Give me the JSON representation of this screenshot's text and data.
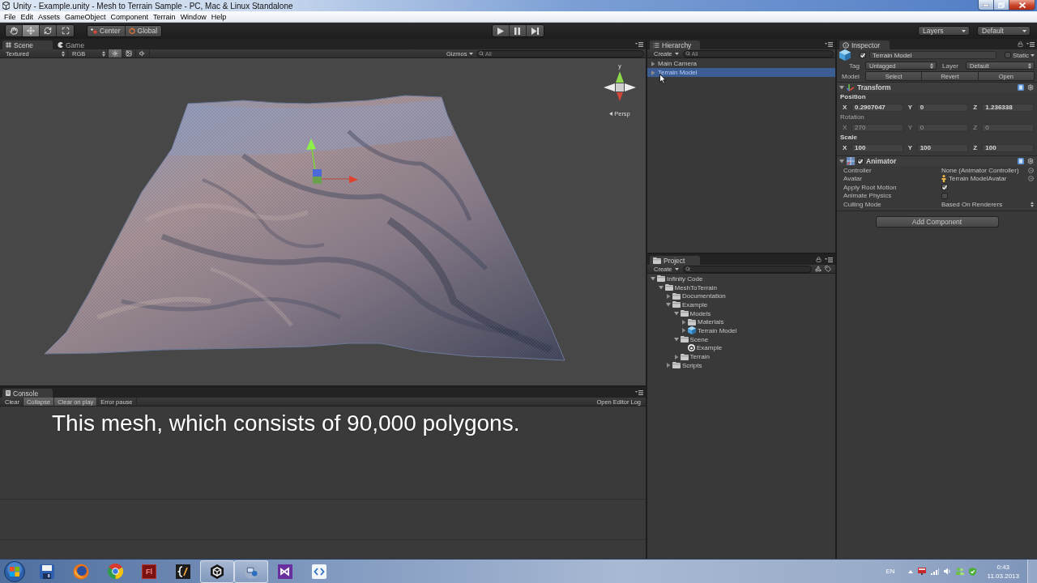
{
  "window": {
    "title": "Unity - Example.unity - Mesh to Terrain Sample - PC, Mac & Linux Standalone"
  },
  "menu": [
    "File",
    "Edit",
    "Assets",
    "GameObject",
    "Component",
    "Terrain",
    "Window",
    "Help"
  ],
  "toolbar": {
    "tools": [
      {
        "kind": "hand",
        "selected": false
      },
      {
        "kind": "move",
        "selected": true
      },
      {
        "kind": "rotate",
        "selected": false
      },
      {
        "kind": "scale",
        "selected": false
      }
    ],
    "pivot": [
      {
        "kind": "center",
        "label": "Center"
      },
      {
        "kind": "global",
        "label": "Global"
      }
    ],
    "playback": [
      {
        "kind": "play",
        "on": false
      },
      {
        "kind": "pause",
        "on": false
      },
      {
        "kind": "step",
        "on": false
      }
    ],
    "layers": "Layers",
    "layout": "Default"
  },
  "scene": {
    "tabs": [
      {
        "kind": "scene",
        "label": "Scene",
        "selected": true
      },
      {
        "kind": "game",
        "label": "Game",
        "selected": false
      }
    ],
    "render_mode": "Textured",
    "channel": "RGB",
    "toggles": [
      {
        "kind": "lighting",
        "on": true
      },
      {
        "kind": "skybox",
        "on": false
      },
      {
        "kind": "audio",
        "on": false
      }
    ],
    "gizmos": "Gizmos",
    "search_placeholder": "All",
    "axis_label": "y",
    "projection": "Persp"
  },
  "console": {
    "tab": "Console",
    "buttons": [
      {
        "label": "Clear",
        "on": false
      },
      {
        "label": "Collapse",
        "on": true
      },
      {
        "label": "Clear on play",
        "on": true
      },
      {
        "label": "Error pause",
        "on": false
      }
    ],
    "editor_log": "Open Editor Log"
  },
  "subtitle": "This mesh, which consists of 90,000 polygons.",
  "hierarchy": {
    "tab": "Hierarchy",
    "create": "Create",
    "search_placeholder": "All",
    "items": [
      {
        "label": "Main Camera",
        "expanded": false,
        "selected": false
      },
      {
        "label": "Terrain Model",
        "expanded": false,
        "selected": true
      }
    ]
  },
  "project": {
    "tab": "Project",
    "create": "Create",
    "tree": [
      {
        "label": "Infinity Code",
        "kind": "folder",
        "expanded": true,
        "children": [
          {
            "label": "MeshToTerrain",
            "kind": "folder",
            "expanded": true,
            "children": [
              {
                "label": "Documentation",
                "kind": "folder",
                "expanded": false
              },
              {
                "label": "Example",
                "kind": "folder",
                "expanded": true,
                "children": [
                  {
                    "label": "Models",
                    "kind": "folder",
                    "expanded": true,
                    "children": [
                      {
                        "label": "Materials",
                        "kind": "folder",
                        "expanded": false
                      },
                      {
                        "label": "Terrain Model",
                        "kind": "model",
                        "expanded": false
                      }
                    ]
                  },
                  {
                    "label": "Scene",
                    "kind": "folder",
                    "expanded": true,
                    "children": [
                      {
                        "label": "Example",
                        "kind": "scene"
                      }
                    ]
                  },
                  {
                    "label": "Terrain",
                    "kind": "folder",
                    "expanded": false
                  }
                ]
              },
              {
                "label": "Scripts",
                "kind": "folder",
                "expanded": false
              }
            ]
          }
        ]
      }
    ]
  },
  "inspector": {
    "tab": "Inspector",
    "object": {
      "active": true,
      "name": "Terrain Model",
      "static": false,
      "static_label": "Static",
      "tag_label": "Tag",
      "tag": "Untagged",
      "layer_label": "Layer",
      "layer": "Default",
      "model_label": "Model",
      "model_buttons": [
        "Select",
        "Revert",
        "Open"
      ]
    },
    "components": [
      {
        "kind": "transform",
        "title": "Transform",
        "expanded": true,
        "vectors": [
          {
            "label": "Position",
            "modified": true,
            "axes": [
              {
                "axis": "X",
                "value": "0.2907047"
              },
              {
                "axis": "Y",
                "value": "0"
              },
              {
                "axis": "Z",
                "value": "1.236338"
              }
            ]
          },
          {
            "label": "Rotation",
            "modified": false,
            "axes": [
              {
                "axis": "X",
                "value": "270"
              },
              {
                "axis": "Y",
                "value": "0"
              },
              {
                "axis": "Z",
                "value": "0"
              }
            ]
          },
          {
            "label": "Scale",
            "modified": true,
            "axes": [
              {
                "axis": "X",
                "value": "100"
              },
              {
                "axis": "Y",
                "value": "100"
              },
              {
                "axis": "Z",
                "value": "100"
              }
            ]
          }
        ]
      },
      {
        "kind": "animator",
        "title": "Animator",
        "expanded": true,
        "enabled": true,
        "fields": [
          {
            "kind": "object",
            "label": "Controller",
            "value": "None (Animator Controller)"
          },
          {
            "kind": "avatar",
            "label": "Avatar",
            "value": "Terrain ModelAvatar"
          },
          {
            "kind": "checkbox",
            "label": "Apply Root Motion",
            "checked": true
          },
          {
            "kind": "checkbox",
            "label": "Animate Physics",
            "checked": false
          },
          {
            "kind": "dropdown",
            "label": "Culling Mode",
            "value": "Based On Renderers"
          }
        ]
      }
    ],
    "add_component": "Add Component"
  },
  "taskbar": {
    "apps": [
      {
        "kind": "disk",
        "running": false
      },
      {
        "kind": "fox",
        "running": false
      },
      {
        "kind": "wheel",
        "running": false
      },
      {
        "kind": "tile",
        "label": "Fl",
        "running": false
      },
      {
        "kind": "brace",
        "running": false
      },
      {
        "kind": "unity",
        "running": true
      },
      {
        "kind": "remote",
        "running": true
      },
      {
        "kind": "studio",
        "running": false
      },
      {
        "kind": "code",
        "running": false
      }
    ],
    "language": "EN",
    "time": "0:43",
    "date": "11.03.2013"
  }
}
